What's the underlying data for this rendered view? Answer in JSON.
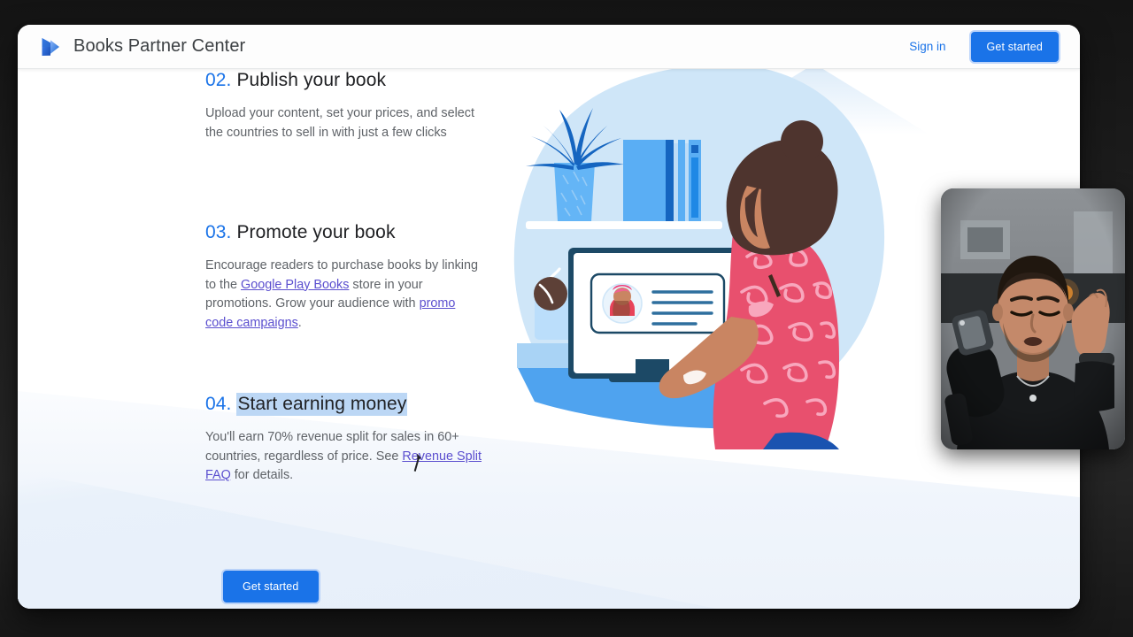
{
  "header": {
    "brand_name": "Books Partner Center",
    "logo_icon": "google-play-books-logo",
    "sign_in_label": "Sign in",
    "get_started_label": "Get started"
  },
  "steps": [
    {
      "number": "02.",
      "title": "Publish your book",
      "body_parts": [
        {
          "type": "text",
          "text": "Upload your content, set your prices, and select the countries to sell in with just a few clicks"
        }
      ]
    },
    {
      "number": "03.",
      "title": "Promote your book",
      "body_parts": [
        {
          "type": "text",
          "text": "Encourage readers to purchase books by linking to the "
        },
        {
          "type": "link",
          "text": "Google Play Books"
        },
        {
          "type": "text",
          "text": " store in your promotions. Grow your audience with "
        },
        {
          "type": "link",
          "text": "promo code campaigns"
        },
        {
          "type": "text",
          "text": "."
        }
      ]
    },
    {
      "number": "04.",
      "title": "Start earning money",
      "title_selected": true,
      "body_parts": [
        {
          "type": "text",
          "text": "You'll earn 70% revenue split for sales in 60+ countries, regardless of price. See "
        },
        {
          "type": "link",
          "text": "Revenue Split FAQ"
        },
        {
          "type": "text",
          "text": " for details."
        }
      ]
    }
  ],
  "cta": {
    "get_started_label": "Get started"
  },
  "illustration": {
    "name": "woman-at-desktop-computer-illustration",
    "elements": [
      "background-blob",
      "potted-plant",
      "books-on-shelf",
      "shelf",
      "desktop-monitor",
      "profile-card-on-screen",
      "coffee-mug",
      "woman-with-bun",
      "desk"
    ]
  },
  "webcam": {
    "name": "presenter-webcam-overlay",
    "elements": [
      "person-speaking",
      "microphone",
      "kitchen-background"
    ]
  },
  "colors": {
    "accent_blue": "#1a73e8",
    "link_purple": "#5b4fcf",
    "selection_blue": "#bcd7f5",
    "text_primary": "#202124",
    "text_secondary": "#5f6368",
    "illustration_blob": "#cfe6f8",
    "page_background": "#ffffff",
    "bezel": "#1d1d1d"
  }
}
